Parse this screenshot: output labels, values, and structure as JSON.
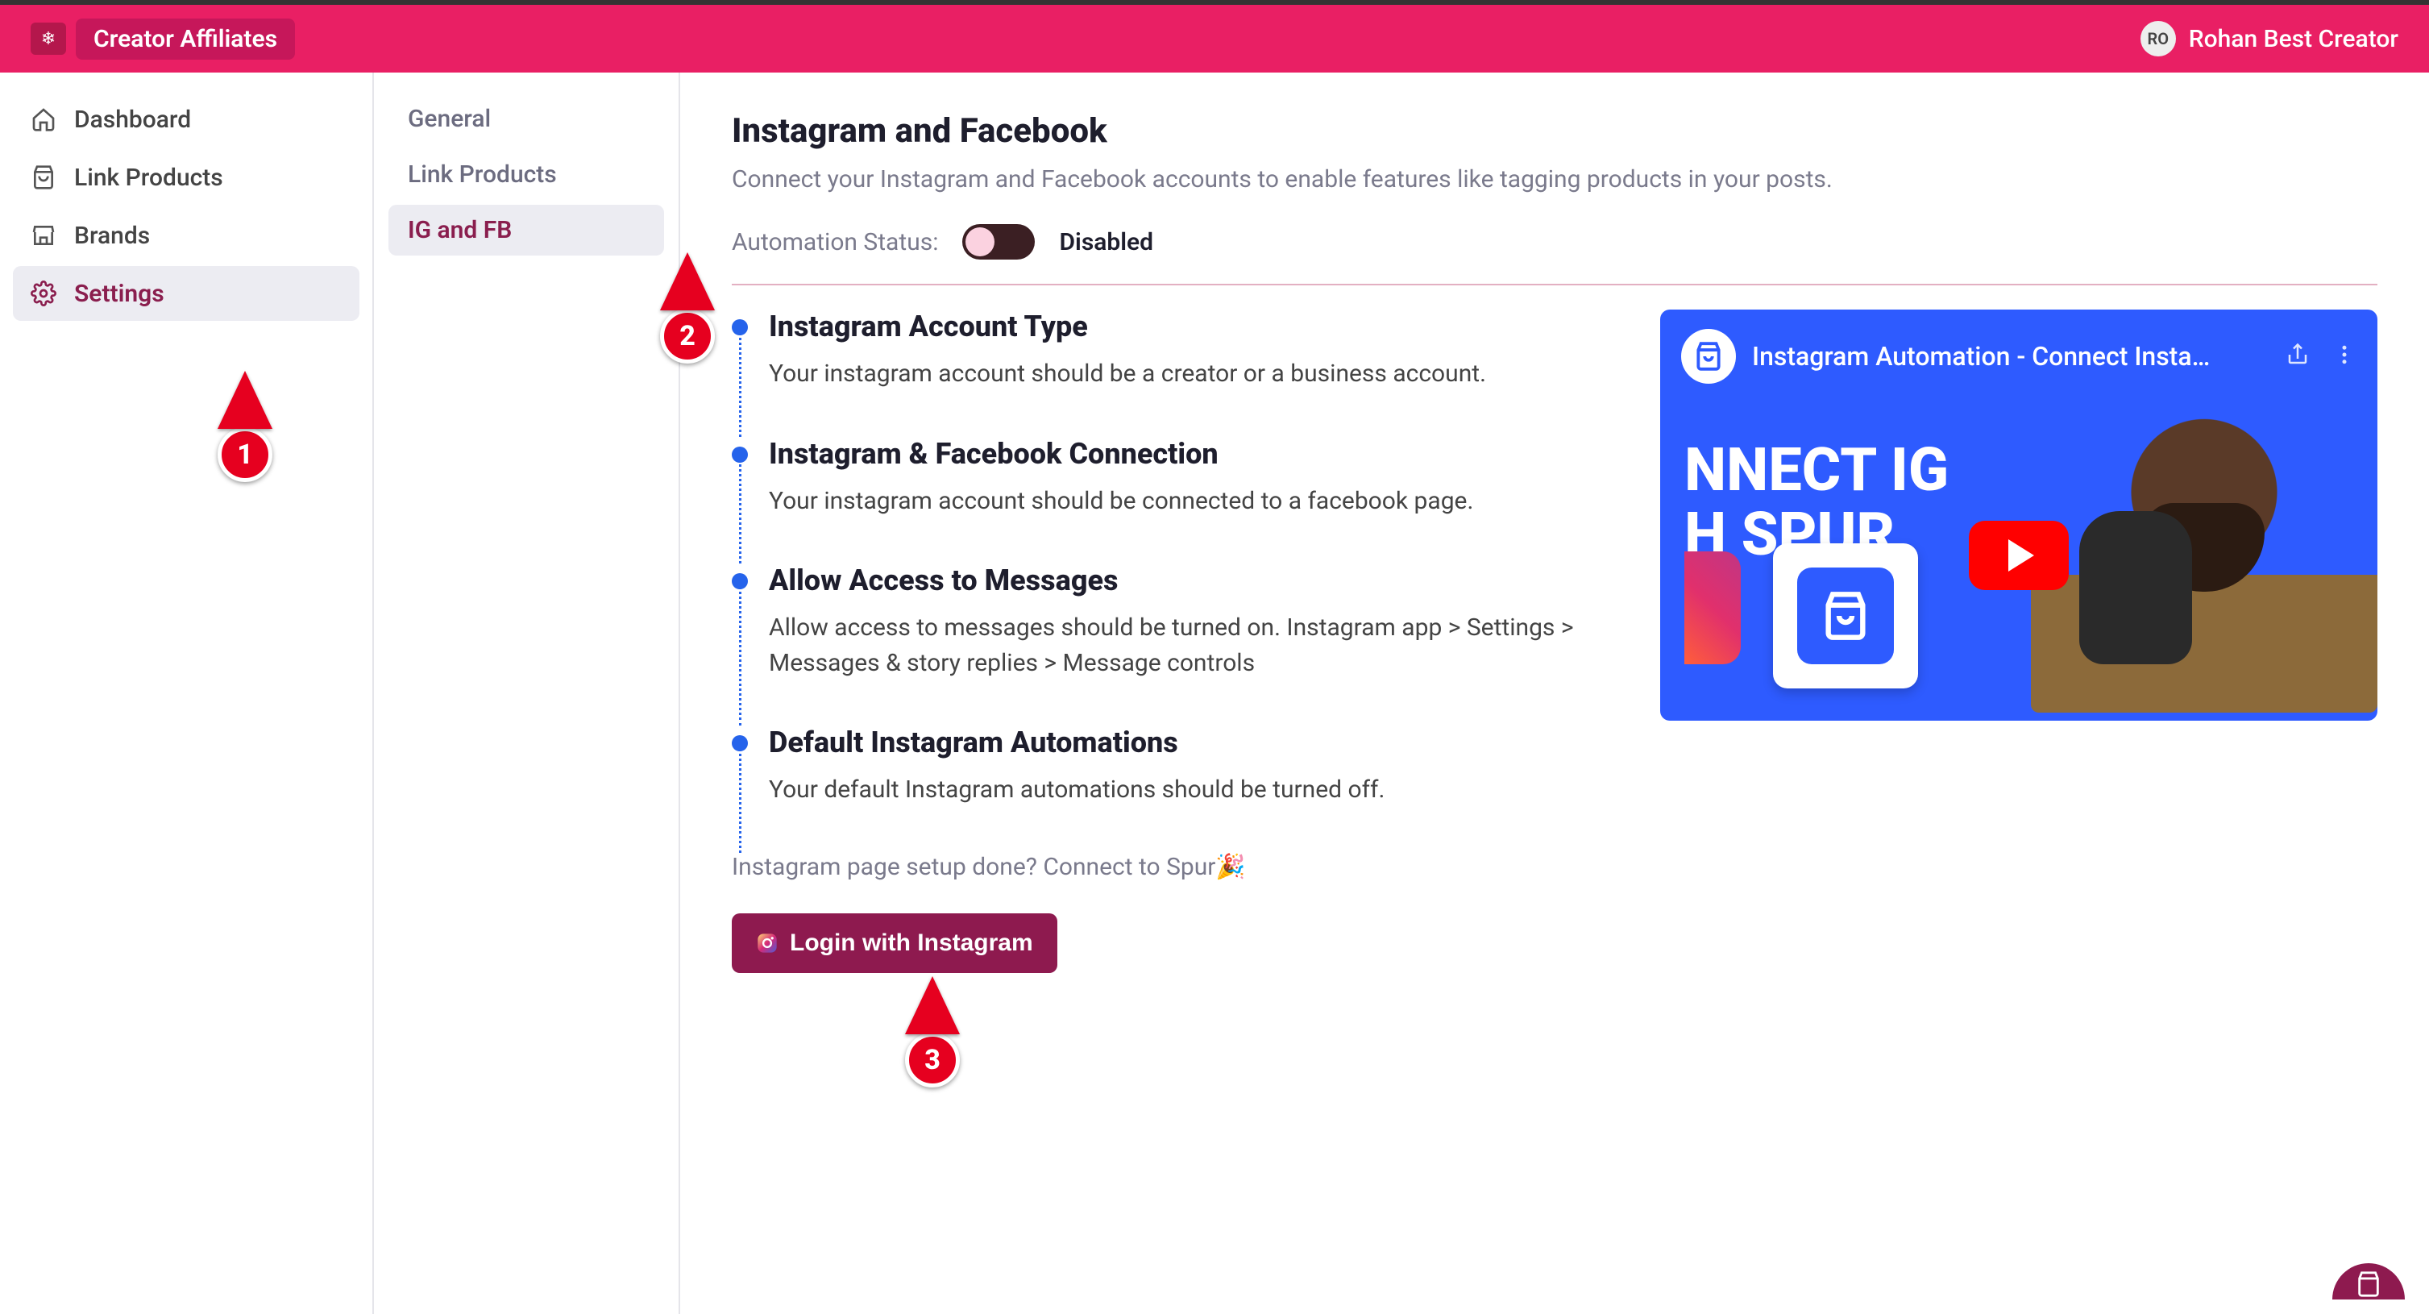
{
  "topbar": {
    "brand_label": "Creator Affiliates",
    "user_avatar_initials": "RO",
    "user_name": "Rohan Best Creator"
  },
  "sidebar": {
    "items": [
      {
        "label": "Dashboard",
        "icon": "home-icon"
      },
      {
        "label": "Link Products",
        "icon": "bag-icon"
      },
      {
        "label": "Brands",
        "icon": "store-icon"
      },
      {
        "label": "Settings",
        "icon": "gear-icon"
      }
    ],
    "active_index": 3
  },
  "subsidebar": {
    "items": [
      {
        "label": "General"
      },
      {
        "label": "Link Products"
      },
      {
        "label": "IG and FB"
      }
    ],
    "active_index": 2
  },
  "content": {
    "title": "Instagram and Facebook",
    "subtitle": "Connect your Instagram and Facebook accounts to enable features like tagging products in your posts.",
    "automation_label": "Automation Status:",
    "automation_value": "Disabled",
    "steps": [
      {
        "title": "Instagram Account Type",
        "desc": "Your instagram account should be a creator or a business account."
      },
      {
        "title": "Instagram & Facebook Connection",
        "desc": "Your instagram account should be connected to a facebook page."
      },
      {
        "title": "Allow Access to Messages",
        "desc": "Allow access to messages should be turned on. Instagram app > Settings > Messages & story replies > Message controls"
      },
      {
        "title": "Default Instagram Automations",
        "desc": "Your default Instagram automations should be turned off."
      }
    ],
    "setup_done_text": "Instagram page setup done? Connect to Spur🎉",
    "login_button_label": "Login with Instagram",
    "video_title": "Instagram Automation - Connect Insta…",
    "video_text_line1": "NNECT IG",
    "video_text_line2": "H SPUR"
  },
  "annotations": {
    "marker1": "1",
    "marker2": "2",
    "marker3": "3"
  }
}
